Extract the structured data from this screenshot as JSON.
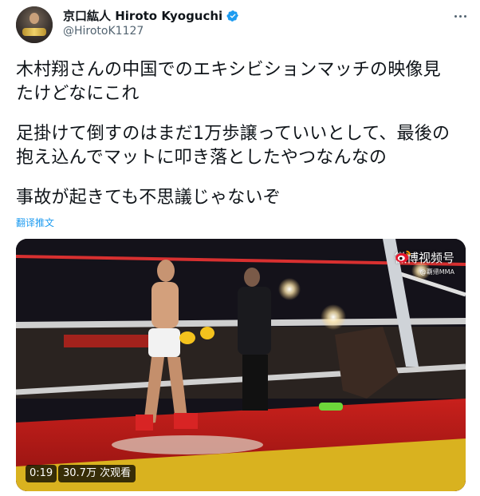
{
  "author": {
    "name": "京口紘人 Hiroto Kyoguchi",
    "handle": "@HirotoK1127",
    "verified": true
  },
  "tweet": {
    "lines": [
      "木村翔さんの中国でのエキシビションマッチの映像見",
      "たけどなにこれ",
      "足掛けて倒すのはまだ1万歩譲っていいとして、最後の",
      "抱え込んでマットに叩き落としたやつなんなの",
      "事故が起きても不思議じゃないぞ"
    ],
    "translate_label": "翻译推文"
  },
  "media": {
    "watermark": "微博视频号",
    "watermark_sub": "@覇帰MMA",
    "time": "0:19",
    "views": "30.7万 次观看"
  },
  "icons": {
    "verified": "verified-badge-icon",
    "more": "more-options-icon",
    "weibo": "weibo-logo-icon"
  },
  "colors": {
    "accent": "#1d9bf0",
    "text": "#0f1419",
    "secondary": "#536471"
  }
}
